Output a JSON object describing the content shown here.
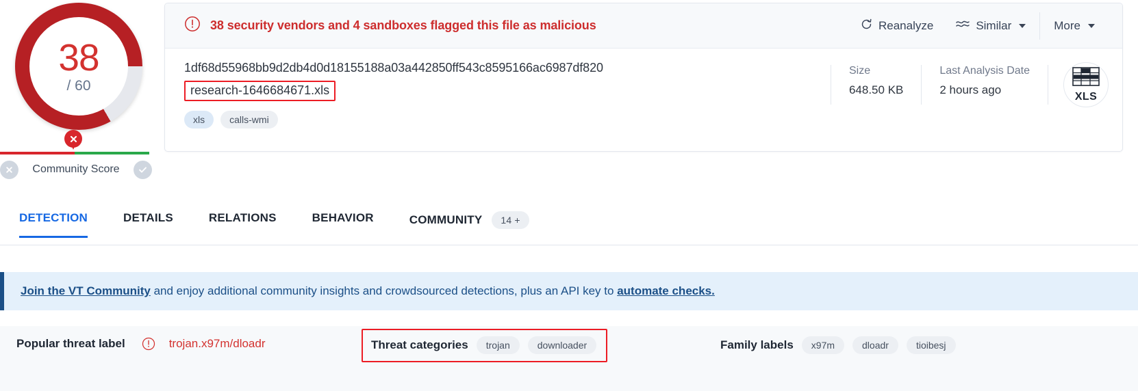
{
  "score": {
    "detections": "38",
    "total": "/ 60",
    "community_label": "Community Score",
    "verdict_icon": "x-mark-icon",
    "thumbs_down_icon": "x-circle-icon",
    "thumbs_up_icon": "check-circle-icon",
    "ring_color": "#b62024",
    "ring_track_color": "#e6e8ed",
    "number_color": "#d3322f",
    "bar_malicious_color": "#d8262c",
    "bar_harmless_color": "#2aa84a"
  },
  "card": {
    "alert": {
      "icon": "exclamation-circle-icon",
      "text": "38 security vendors and 4 sandboxes flagged this file as malicious",
      "color": "#cd2d2d"
    },
    "actions": {
      "reanalyze": "Reanalyze",
      "reanalyze_icon": "refresh-icon",
      "similar": "Similar",
      "similar_icon": "similar-waves-icon",
      "more": "More"
    },
    "file": {
      "hash": "1df68d55968bb9d2db4d0d18155188a03a442850ff543c8595166ac6987df820",
      "name": "research-1646684671.xls",
      "tags": [
        {
          "label": "xls",
          "style": "blue"
        },
        {
          "label": "calls-wmi",
          "style": "gray"
        }
      ]
    },
    "meta": [
      {
        "label": "Size",
        "value": "648.50 KB"
      },
      {
        "label": "Last Analysis Date",
        "value": "2 hours ago"
      }
    ],
    "filetype": {
      "icon": "spreadsheet-icon",
      "name": "XLS"
    }
  },
  "tabs": [
    {
      "label": "DETECTION",
      "active": true,
      "badge": null
    },
    {
      "label": "DETAILS",
      "active": false,
      "badge": null
    },
    {
      "label": "RELATIONS",
      "active": false,
      "badge": null
    },
    {
      "label": "BEHAVIOR",
      "active": false,
      "badge": null
    },
    {
      "label": "COMMUNITY",
      "active": false,
      "badge": "14 +"
    }
  ],
  "banner": {
    "link_start": "Join the VT Community",
    "middle": " and enjoy additional community insights and crowdsourced detections, plus an API key to ",
    "link_end": "automate checks.",
    "accent_color": "#1b4f87"
  },
  "threat": {
    "popular_title": "Popular threat label",
    "popular_icon": "exclamation-circle-icon",
    "popular_value": "trojan.x97m/dloadr",
    "categories_title": "Threat categories",
    "categories": [
      "trojan",
      "downloader"
    ],
    "family_title": "Family labels",
    "families": [
      "x97m",
      "dloadr",
      "tioibesj"
    ],
    "highlight_color": "#ec1c24"
  }
}
